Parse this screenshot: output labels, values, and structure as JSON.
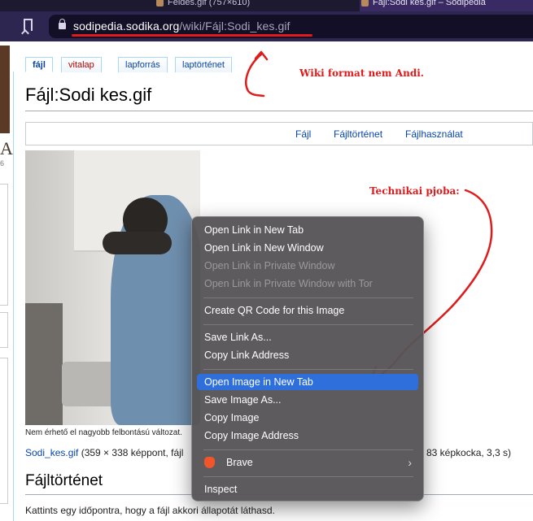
{
  "browser": {
    "tabs": [
      {
        "label": "Feldes.gif (757×610)"
      },
      {
        "label": "Fájl:Sodi kes.gif – Sodipedia"
      }
    ],
    "url_host": "sodipedia.sodika.org",
    "url_path": "/wiki/Fájl:Sodi_kes.gif"
  },
  "wiki": {
    "tabs": [
      {
        "label": "fájl"
      },
      {
        "label": "vitalap"
      },
      {
        "label": "lapforrás"
      },
      {
        "label": "laptörténet"
      }
    ],
    "page_title": "Fájl:Sodi kes.gif",
    "file_toc": [
      "Fájl",
      "Fájltörténet",
      "Fájlhasználat"
    ],
    "caption": "Nem érhető el nagyobb felbontású változat.",
    "file_link": "Sodi_kes.gif",
    "file_meta": " (359 × 338 képpont, fájl",
    "file_meta_right": "83 képkocka, 3,3 s)",
    "section_heading": "Fájltörténet",
    "section_text": "Kattints egy időpontra, hogy a fájl akkori állapotát láthasd.",
    "sidebar_letter": "A",
    "sidebar_num": "6"
  },
  "annotations": {
    "wiki_format": "Wiki format nem Andi.",
    "technikai": "Technikai pjoba:"
  },
  "context_menu": {
    "groups": [
      [
        "Open Link in New Tab",
        "Open Link in New Window",
        "Open Link in Private Window",
        "Open Link in Private Window with Tor"
      ],
      [
        "Create QR Code for this Image"
      ],
      [
        "Save Link As...",
        "Copy Link Address"
      ],
      [
        "Open Image in New Tab",
        "Save Image As...",
        "Copy Image",
        "Copy Image Address"
      ],
      [
        "Brave"
      ],
      [
        "Inspect"
      ]
    ],
    "disabled": [
      "Open Link in Private Window",
      "Open Link in Private Window with Tor"
    ],
    "highlighted": "Open Image in New Tab"
  },
  "colors": {
    "annotation_red": "#e01b1b",
    "menu_highlight": "#2f6fdc",
    "link_blue": "#0645ad"
  }
}
